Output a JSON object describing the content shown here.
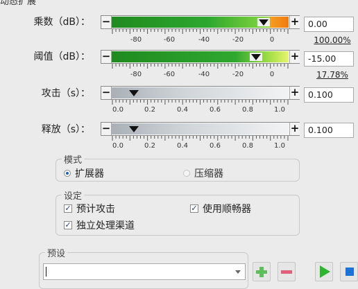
{
  "window": {
    "title": "动态扩展"
  },
  "gain": {
    "label": "乘数（dB）：",
    "minus": "−",
    "plus": "+",
    "value": "0.00",
    "percent": "100.00%",
    "ticks": [
      "-80",
      "-60",
      "-40",
      "-20",
      "0"
    ],
    "level_fraction": 1.0
  },
  "threshold": {
    "label": "阈值（dB）：",
    "minus": "−",
    "plus": "+",
    "value": "-15.00",
    "percent": "17.78%",
    "ticks": [
      "-80",
      "-60",
      "-40",
      "-20",
      "0"
    ],
    "level_fraction": 0.83
  },
  "attack": {
    "label": "攻击（s）：",
    "minus": "−",
    "plus": "+",
    "value": "0.100",
    "ticks": [
      "0.0",
      "0.2",
      "0.4",
      "0.6",
      "0.8",
      "1.0"
    ],
    "level_fraction": 0.1
  },
  "release": {
    "label": "释放（s）：",
    "minus": "−",
    "plus": "+",
    "value": "0.100",
    "ticks": [
      "0.0",
      "0.2",
      "0.4",
      "0.6",
      "0.8",
      "1.0"
    ],
    "level_fraction": 0.1
  },
  "mode": {
    "title": "模式",
    "expander_label": "扩展器",
    "compressor_label": "压缩器",
    "selected": "扩展器"
  },
  "settings": {
    "title": "设定",
    "lookahead_label": "预计攻击",
    "lookahead_checked": true,
    "smoothing_label": "使用顺畅器",
    "smoothing_checked": true,
    "independent_label": "独立处理渠道",
    "independent_checked": true
  },
  "presets": {
    "title": "预设",
    "current_value": "",
    "dropdown_icon": "chevron-down-icon",
    "add_icon": "plus-icon",
    "remove_icon": "minus-icon",
    "play_icon": "play-icon",
    "stop_icon": "stop-icon"
  },
  "colors": {
    "play": "#2db52d",
    "stop": "#1b73d6",
    "add": "#5cbf5c",
    "remove": "#e0607a"
  }
}
